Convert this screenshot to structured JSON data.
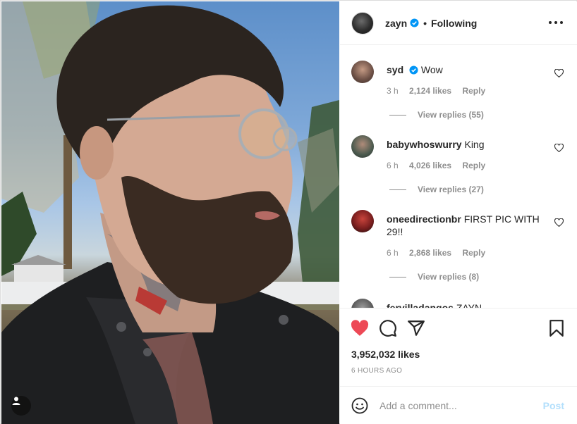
{
  "post": {
    "author": "zayn",
    "follow_status": "Following",
    "separator": "•",
    "verified_color": "#0095f6"
  },
  "comments": [
    {
      "username": "syd",
      "verified": true,
      "text": "Wow",
      "age": "3 h",
      "likes": "2,124 likes",
      "reply": "Reply",
      "view_replies": "View replies (55)",
      "avatar_color": "#8a6f63"
    },
    {
      "username": "babywhoswurry",
      "verified": false,
      "text": "King",
      "age": "6 h",
      "likes": "4,026 likes",
      "reply": "Reply",
      "view_replies": "View replies (27)",
      "avatar_color": "#4a5a4c"
    },
    {
      "username": "oneedirectionbr",
      "verified": false,
      "text": "FIRST PIC WITH 29!!",
      "age": "6 h",
      "likes": "2,868 likes",
      "reply": "Reply",
      "view_replies": "View replies (8)",
      "avatar_color": "#7a1e1e"
    },
    {
      "username": "fervilladangos",
      "verified": false,
      "text": "ZAYN",
      "avatar_color": "#555555"
    }
  ],
  "actions": {
    "liked": true,
    "like_color": "#ed4956",
    "likes_count": "3,952,032 likes",
    "time_ago": "6 HOURS AGO"
  },
  "composer": {
    "placeholder": "Add a comment...",
    "post_label": "Post"
  },
  "icons": {
    "more": "more-options-icon",
    "heart": "heart-icon",
    "comment": "comment-icon",
    "share": "share-icon",
    "save": "bookmark-icon",
    "emoji": "emoji-icon",
    "tagged_user": "user-tag-icon"
  }
}
